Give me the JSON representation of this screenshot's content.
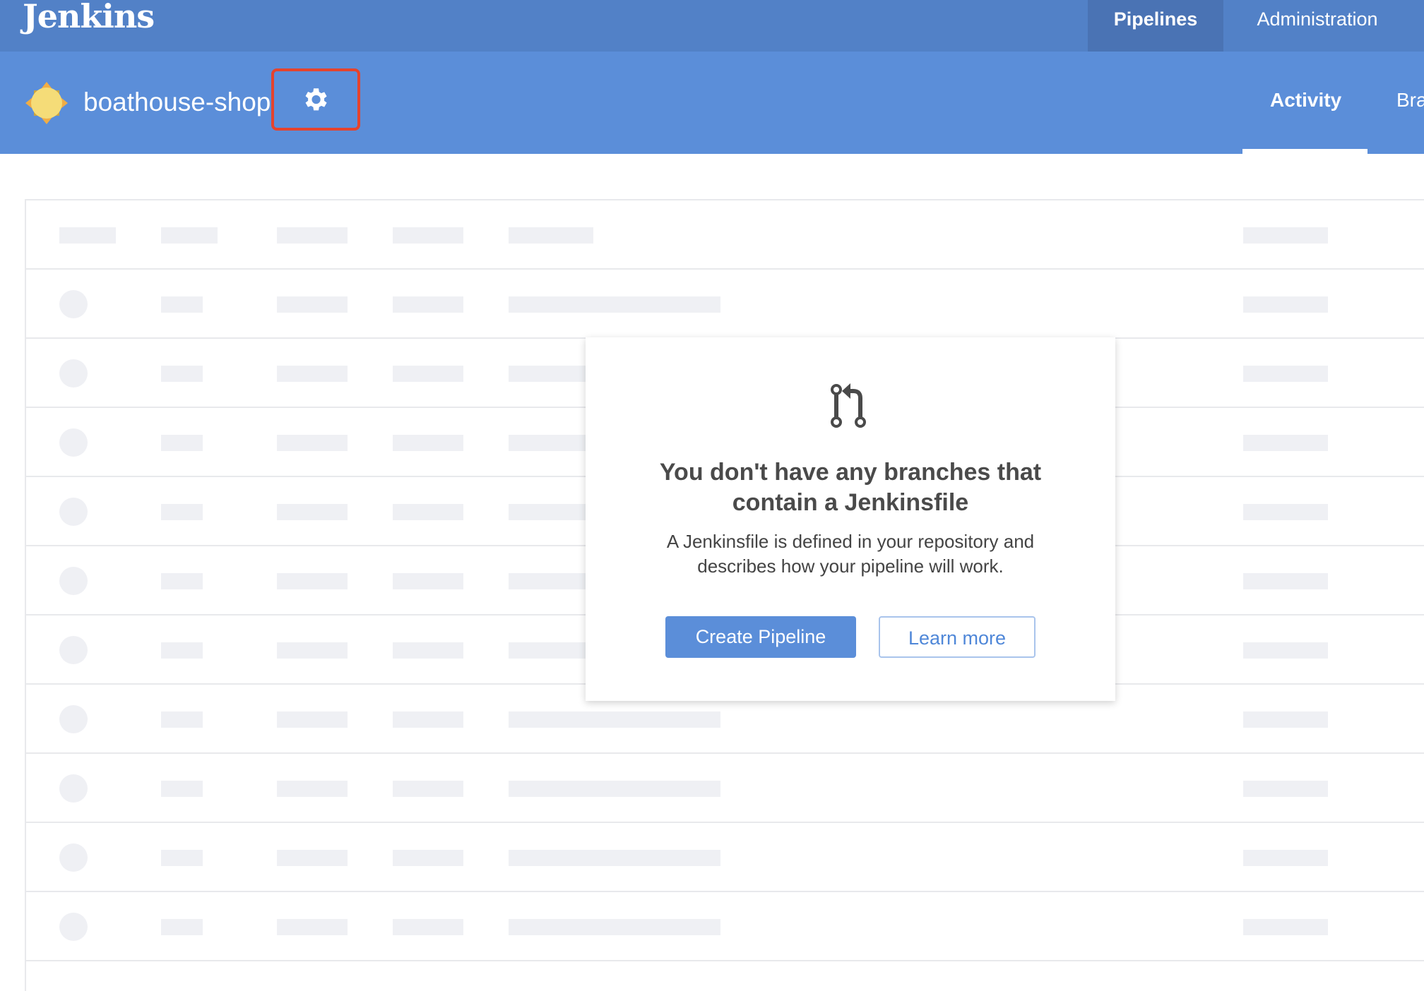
{
  "header": {
    "logo": "Jenkins",
    "nav": [
      {
        "label": "Pipelines",
        "active": true
      },
      {
        "label": "Administration",
        "active": false
      }
    ]
  },
  "project": {
    "name": "boathouse-shop",
    "weather_icon": "sun-icon",
    "settings_icon": "gear-icon",
    "highlight_color": "#e5432d"
  },
  "tabs": [
    {
      "label": "Activity",
      "active": true
    },
    {
      "label": "Bra",
      "active": false
    }
  ],
  "empty_state": {
    "icon": "git-pull-request-icon",
    "title_line1": "You don't have any branches that",
    "title_line2": "contain a Jenkinsfile",
    "body_line1": "A Jenkinsfile is defined in your repository and",
    "body_line2": "describes how your pipeline will work.",
    "primary_button": "Create Pipeline",
    "secondary_button": "Learn more"
  },
  "colors": {
    "top_bar": "#5281c7",
    "sub_bar": "#5b8ed9",
    "accent": "#5b8ed9"
  }
}
